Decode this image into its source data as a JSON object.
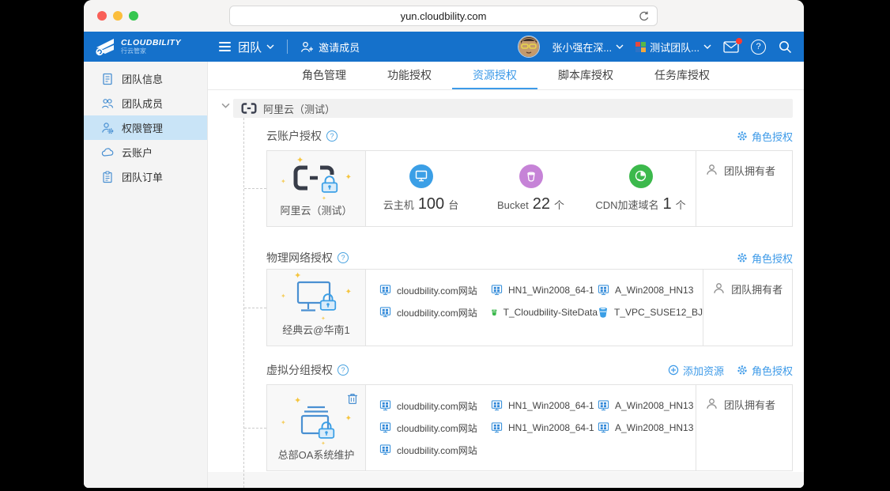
{
  "browser": {
    "url": "yun.cloudbility.com"
  },
  "appbar": {
    "brand_name": "CLOUDBILITY",
    "brand_sub": "行云管家",
    "team_menu_label": "团队",
    "invite_label": "邀请成员",
    "user_label": "张小强在深...",
    "team_label": "测试团队...",
    "accent_color": "#1571cb"
  },
  "sidebar": {
    "items": [
      {
        "label": "团队信息",
        "icon": "document-icon"
      },
      {
        "label": "团队成员",
        "icon": "people-icon"
      },
      {
        "label": "权限管理",
        "icon": "person-gear-icon",
        "active": true
      },
      {
        "label": "云账户",
        "icon": "cloud-icon"
      },
      {
        "label": "团队订单",
        "icon": "clipboard-icon"
      }
    ]
  },
  "tabs": [
    {
      "label": "角色管理"
    },
    {
      "label": "功能授权"
    },
    {
      "label": "资源授权",
      "active": true
    },
    {
      "label": "脚本库授权"
    },
    {
      "label": "任务库授权"
    }
  ],
  "group": {
    "title": "阿里云（测试）"
  },
  "sections": [
    {
      "title": "云账户授权",
      "entity_label": "阿里云（测试）",
      "role_link": "角色授权",
      "owner": "团队拥有者",
      "stats": [
        {
          "label": "云主机",
          "value": "100",
          "unit": "台",
          "color": "#3b9fe6"
        },
        {
          "label": "Bucket",
          "value": "22",
          "unit": "个",
          "color": "#c683d7"
        },
        {
          "label": "CDN加速域名",
          "value": "1",
          "unit": "个",
          "color": "#3cb94c"
        }
      ]
    },
    {
      "title": "物理网络授权",
      "entity_label": "经典云@华南1",
      "role_link": "角色授权",
      "owner": "团队拥有者",
      "resources": [
        {
          "label": "cloudbility.com网站",
          "icon": "windows-host-icon"
        },
        {
          "label": "HN1_Win2008_64-1",
          "icon": "windows-host-icon"
        },
        {
          "label": "A_Win2008_HN13",
          "icon": "windows-host-icon"
        },
        {
          "label": "cloudbility.com网站",
          "icon": "windows-host-icon"
        },
        {
          "label": "T_Cloudbility-SiteData",
          "icon": "bucket-green-icon"
        },
        {
          "label": "T_VPC_SUSE12_BJ",
          "icon": "bucket-blue-icon"
        }
      ]
    },
    {
      "title": "虚拟分组授权",
      "entity_label": "总部OA系统维护",
      "add_link": "添加资源",
      "role_link": "角色授权",
      "owner": "团队拥有者",
      "resources": [
        {
          "label": "cloudbility.com网站",
          "icon": "windows-host-icon"
        },
        {
          "label": "HN1_Win2008_64-1",
          "icon": "windows-host-icon"
        },
        {
          "label": "A_Win2008_HN13",
          "icon": "windows-host-icon"
        },
        {
          "label": "cloudbility.com网站",
          "icon": "windows-host-icon"
        },
        {
          "label": "HN1_Win2008_64-1",
          "icon": "windows-host-icon"
        },
        {
          "label": "A_Win2008_HN13",
          "icon": "windows-host-icon"
        },
        {
          "label": "cloudbility.com网站",
          "icon": "windows-host-icon"
        }
      ]
    }
  ]
}
